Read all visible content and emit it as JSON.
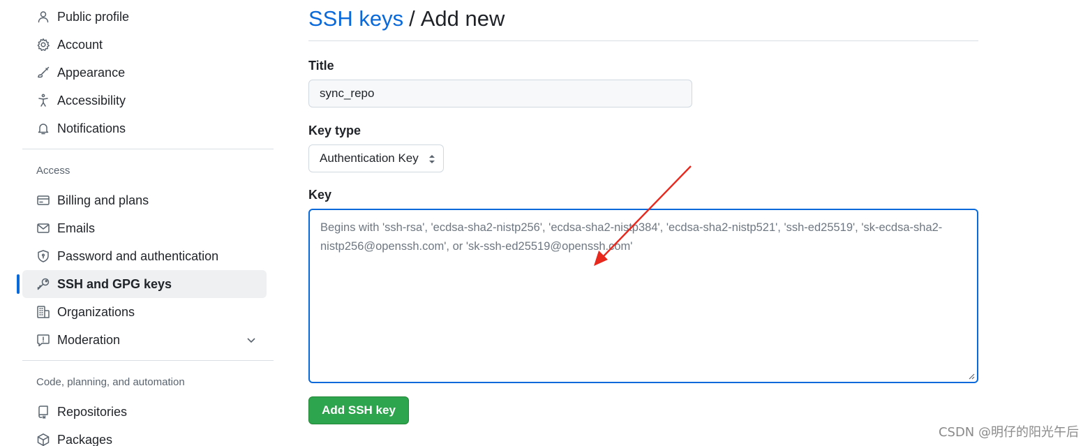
{
  "sidebar": {
    "items_top": [
      {
        "label": "Public profile",
        "icon": "person-icon"
      },
      {
        "label": "Account",
        "icon": "gear-icon"
      },
      {
        "label": "Appearance",
        "icon": "paintbrush-icon"
      },
      {
        "label": "Accessibility",
        "icon": "accessibility-icon"
      },
      {
        "label": "Notifications",
        "icon": "bell-icon"
      }
    ],
    "group_access": "Access",
    "items_access": [
      {
        "label": "Billing and plans",
        "icon": "credit-card-icon"
      },
      {
        "label": "Emails",
        "icon": "mail-icon"
      },
      {
        "label": "Password and authentication",
        "icon": "shield-icon"
      },
      {
        "label": "SSH and GPG keys",
        "icon": "key-icon",
        "active": true
      },
      {
        "label": "Organizations",
        "icon": "organization-icon"
      },
      {
        "label": "Moderation",
        "icon": "report-icon"
      }
    ],
    "group_code": "Code, planning, and automation",
    "items_code": [
      {
        "label": "Repositories",
        "icon": "repo-icon"
      },
      {
        "label": "Packages",
        "icon": "package-icon"
      }
    ]
  },
  "main": {
    "breadcrumb": "SSH keys",
    "separator": "/",
    "title": "Add new",
    "title_label": "Title",
    "title_value": "sync_repo",
    "key_type_label": "Key type",
    "key_type_value": "Authentication Key",
    "key_label": "Key",
    "key_placeholder": "Begins with 'ssh-rsa', 'ecdsa-sha2-nistp256', 'ecdsa-sha2-nistp384', 'ecdsa-sha2-nistp521', 'ssh-ed25519', 'sk-ecdsa-sha2-nistp256@openssh.com', or 'sk-ssh-ed25519@openssh.com'",
    "submit_label": "Add SSH key"
  },
  "colors": {
    "accent": "#0969da",
    "button": "#2da44e",
    "annotation_arrow": "#e8271d"
  },
  "watermark": "CSDN @明仔的阳光午后"
}
